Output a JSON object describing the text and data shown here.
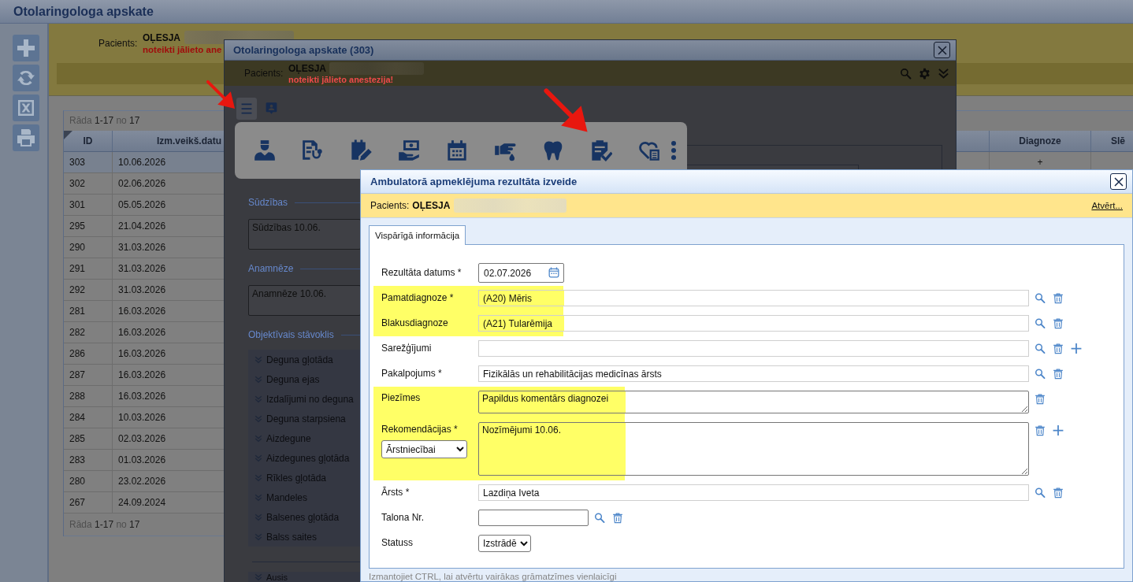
{
  "page": {
    "title": "Otolaringologa apskate"
  },
  "patient_banner": {
    "label": "Pacients:",
    "name": "OĻESJA",
    "warning": "noteikti jālieto ane"
  },
  "visits_table": {
    "pager_top": {
      "label": "Rāda",
      "range": "1-17",
      "of": "no",
      "total": "17"
    },
    "columns": [
      "ID",
      "Izm.veikš.datu",
      "Diagnoze",
      "Slē"
    ],
    "rows": [
      {
        "id": "303",
        "date": "10.06.2026",
        "diagnoze": "+",
        "selected": true
      },
      {
        "id": "302",
        "date": "02.06.2026",
        "selected": false
      },
      {
        "id": "301",
        "date": "05.05.2026",
        "selected": false
      },
      {
        "id": "295",
        "date": "21.04.2026",
        "selected": false
      },
      {
        "id": "290",
        "date": "31.03.2026",
        "selected": false
      },
      {
        "id": "291",
        "date": "31.03.2026",
        "selected": false
      },
      {
        "id": "292",
        "date": "31.03.2026",
        "selected": false
      },
      {
        "id": "281",
        "date": "16.03.2026",
        "selected": false
      },
      {
        "id": "282",
        "date": "16.03.2026",
        "selected": false
      },
      {
        "id": "286",
        "date": "16.03.2026",
        "selected": false
      },
      {
        "id": "287",
        "date": "16.03.2026",
        "selected": false
      },
      {
        "id": "288",
        "date": "16.03.2026",
        "selected": false
      },
      {
        "id": "284",
        "date": "10.03.2026",
        "selected": false
      },
      {
        "id": "285",
        "date": "02.03.2026",
        "selected": false
      },
      {
        "id": "283",
        "date": "01.03.2026",
        "selected": false
      },
      {
        "id": "280",
        "date": "23.02.2026",
        "selected": false
      },
      {
        "id": "267",
        "date": "24.09.2024",
        "selected": false
      }
    ],
    "pager_bottom": {
      "label": "Rāda",
      "range": "1-17",
      "of": "no",
      "total": "17"
    }
  },
  "exam_dialog": {
    "title": "Otolaringologa apskate (303)",
    "patient": {
      "label": "Pacients:",
      "name": "OĻESJA",
      "warning": "noteikti jālieto anestezija!"
    },
    "text_sections": [
      {
        "legend": "Sūdzības",
        "value": "Sūdzības 10.06."
      },
      {
        "legend": "Anamnēze",
        "value": "Anamnēze 10.06."
      }
    ],
    "findings": {
      "legend": "Objektīvais stāvoklis",
      "items": [
        "Deguna gļotāda",
        "Deguna ejas",
        "Izdalījumi no deguna",
        "Deguna starpsiena",
        "Aizdegune",
        "Aizdegunes gļotāda",
        "Rīkles gļotāda",
        "Mandeles",
        "Balsenes gļotāda",
        "Balss saites"
      ]
    },
    "next_group": {
      "items": [
        "Ausis"
      ]
    }
  },
  "result_dialog": {
    "title": "Ambulatorā apmeklējuma rezultāta izveide",
    "patient": {
      "label": "Pacients:",
      "name": "OĻESJA"
    },
    "open_link": "Atvērt...",
    "tabs": [
      {
        "label": "Vispārīgā informācija",
        "selected": true
      }
    ],
    "fields": [
      {
        "kind": "date",
        "label": "Rezultāta datums *",
        "value": "02.07.2026",
        "highlighted": false
      },
      {
        "kind": "lookup",
        "label": "Pamatdiagnoze *",
        "value": "(A20) Mēris",
        "highlighted": true,
        "addable": false
      },
      {
        "kind": "lookup",
        "label": "Blakusdiagnoze",
        "value": "(A21) Tularēmija",
        "highlighted": true,
        "addable": false
      },
      {
        "kind": "lookup",
        "label": "Sarežģījumi",
        "highlighted": false,
        "addable": true
      },
      {
        "kind": "lookup",
        "label": "Pakalpojums *",
        "value": "Fizikālās un rehabilitācijas medicīnas ārsts",
        "highlighted": false,
        "addable": false
      },
      {
        "kind": "note",
        "label": "Piezīmes",
        "value": "Papildus komentārs diagnozei",
        "highlighted": true,
        "addable": false
      },
      {
        "kind": "note",
        "label": "Rekomendācijas *",
        "select": "Ārstniecībai",
        "value": "Nozīmējumi 10.06.",
        "highlighted": true,
        "addable": true
      },
      {
        "kind": "lookup",
        "label": "Ārsts *",
        "value": "Lazdiņa Iveta",
        "highlighted": false,
        "addable": false
      },
      {
        "kind": "short_lookup",
        "label": "Talona Nr.",
        "highlighted": false,
        "addable": false
      },
      {
        "kind": "select",
        "label": "Statuss",
        "value": "Izstrādē",
        "highlighted": false
      }
    ],
    "hint": "Izmantojiet CTRL, lai atvērtu vairākas grāmatzīmes vienlaicīgi"
  }
}
